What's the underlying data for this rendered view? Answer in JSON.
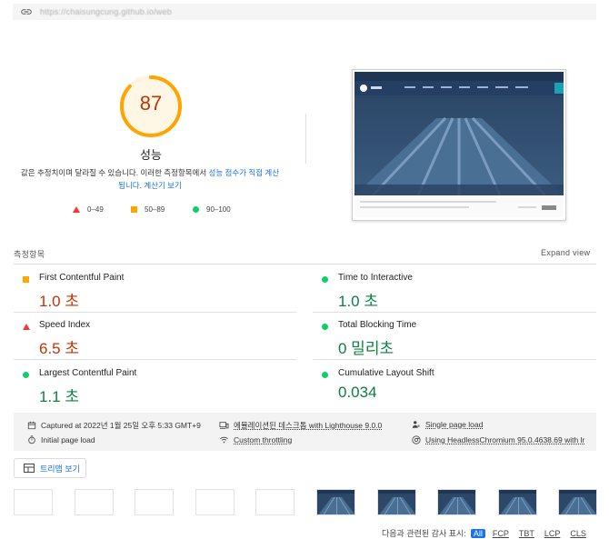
{
  "url_bar": {
    "url": "https://chaisungcung.github.io/web"
  },
  "summary": {
    "score": "87",
    "title": "성능",
    "desc_prefix": "값은 추정치이며 달라질 수 있습니다. 이러한 측정항목에서 ",
    "desc_link1": "성능 점수가 직접 계산됩니다",
    "desc_mid": ". ",
    "desc_link2": "계산기 보기",
    "score_fraction": 0.87,
    "gauge_color": "#ffa400"
  },
  "legend": [
    {
      "shape": "triangle",
      "range": "0–49",
      "color": "#ff3333"
    },
    {
      "shape": "square",
      "range": "50–89",
      "color": "#ffa400"
    },
    {
      "shape": "circle",
      "range": "90–100",
      "color": "#0cce6b"
    }
  ],
  "metrics_section": {
    "label": "측정항목",
    "expand": "Expand view"
  },
  "metrics": [
    {
      "title": "First Contentful Paint",
      "value": "1.0 초",
      "rating": "average"
    },
    {
      "title": "Time to Interactive",
      "value": "1.0 초",
      "rating": "pass"
    },
    {
      "title": "Speed Index",
      "value": "6.5 초",
      "rating": "fail"
    },
    {
      "title": "Total Blocking Time",
      "value": "0 밀리초",
      "rating": "pass"
    },
    {
      "title": "Largest Contentful Paint",
      "value": "1.1 초",
      "rating": "pass"
    },
    {
      "title": "Cumulative Layout Shift",
      "value": "0.034",
      "rating": "pass"
    }
  ],
  "runtime_info": {
    "captured": "Captured at 2022년 1월 25일 오후 5:33 GMT+9",
    "device": "에뮬레이션된 데스크톱 with Lighthouse 9.0.0",
    "session": "Single page load",
    "load": "Initial page load",
    "throttling": "Custom throttling",
    "browser": "Using HeadlessChromium 95.0.4638.69 with lr"
  },
  "treemap_button": "트리맵 보기",
  "filmstrip": {
    "frames": [
      "blank",
      "blank",
      "blank",
      "blank",
      "blank",
      "loaded",
      "loaded",
      "loaded",
      "loaded",
      "loaded"
    ]
  },
  "audit_filter": {
    "label": "다음과 관련된 감사 표시:",
    "options": [
      "All",
      "FCP",
      "TBT",
      "LCP",
      "CLS"
    ],
    "active": "All"
  },
  "colors": {
    "fail": "#c33300",
    "pass": "#0b8043",
    "average": "#ffa400",
    "link": "#1a73e8"
  }
}
